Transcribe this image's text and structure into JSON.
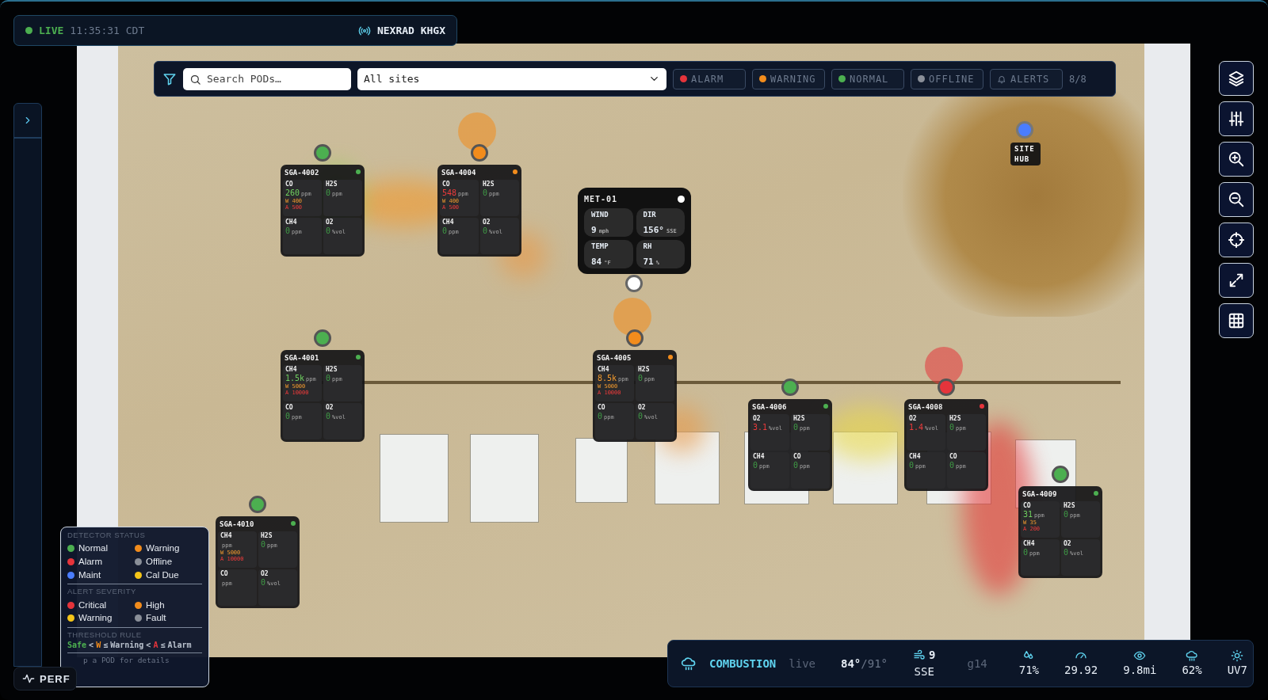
{
  "header": {
    "live_label": "LIVE",
    "live": true,
    "time": "11:35:31 CDT",
    "radar": "NEXRAD KHGX"
  },
  "filter_bar": {
    "search": {
      "placeholder": "Search PODs…"
    },
    "site_select": {
      "value": "All sites"
    },
    "chips": [
      {
        "label": "ALARM",
        "color": "#e5343b",
        "selected": false
      },
      {
        "label": "WARNING",
        "color": "#f28c1c",
        "selected": false
      },
      {
        "label": "NORMAL",
        "color": "#4caf50",
        "selected": false
      },
      {
        "label": "OFFLINE",
        "color": "#8a8f98",
        "selected": false
      },
      {
        "label": "ALERTS",
        "kind": "bell",
        "selected": false
      }
    ],
    "count": "8/8"
  },
  "pods": [
    {
      "id": "SGA-4002",
      "color": "#4caf50",
      "pulse": false,
      "cells": [
        {
          "gas": "CO",
          "value": "260",
          "unit": "ppm",
          "color": "#6fcf5f",
          "warn": "W 400",
          "alarm": "A 500"
        },
        {
          "gas": "H2S",
          "value": "0",
          "unit": "ppm",
          "color": "#3f9a45"
        },
        {
          "gas": "CH4",
          "value": "0",
          "unit": "ppm",
          "color": "#3f9a45"
        },
        {
          "gas": "O2",
          "value": "0",
          "unit": "%vol",
          "color": "#3f9a45"
        }
      ]
    },
    {
      "id": "SGA-4004",
      "color": "#f28c1c",
      "pulse": true,
      "cells": [
        {
          "gas": "CO",
          "value": "548",
          "unit": "ppm",
          "color": "#ee3b3b",
          "warn": "W 400",
          "alarm": "A 500"
        },
        {
          "gas": "H2S",
          "value": "0",
          "unit": "ppm",
          "color": "#3f9a45"
        },
        {
          "gas": "CH4",
          "value": "0",
          "unit": "ppm",
          "color": "#3f9a45"
        },
        {
          "gas": "O2",
          "value": "0",
          "unit": "%vol",
          "color": "#3f9a45"
        }
      ]
    },
    {
      "id": "SGA-4001",
      "color": "#4caf50",
      "pulse": false,
      "cells": [
        {
          "gas": "CH4",
          "value": "1.5k",
          "unit": "ppm",
          "color": "#6fcf5f",
          "warn": "W 5000",
          "alarm": "A 10000"
        },
        {
          "gas": "H2S",
          "value": "0",
          "unit": "ppm",
          "color": "#3f9a45"
        },
        {
          "gas": "CO",
          "value": "0",
          "unit": "ppm",
          "color": "#3f9a45"
        },
        {
          "gas": "O2",
          "value": "0",
          "unit": "%vol",
          "color": "#3f9a45"
        }
      ]
    },
    {
      "id": "SGA-4005",
      "color": "#f28c1c",
      "pulse": true,
      "cells": [
        {
          "gas": "CH4",
          "value": "8.5k",
          "unit": "ppm",
          "color": "#f29a2e",
          "warn": "W 5000",
          "alarm": "A 10000"
        },
        {
          "gas": "H2S",
          "value": "0",
          "unit": "ppm",
          "color": "#3f9a45"
        },
        {
          "gas": "CO",
          "value": "0",
          "unit": "ppm",
          "color": "#3f9a45"
        },
        {
          "gas": "O2",
          "value": "0",
          "unit": "%vol",
          "color": "#3f9a45"
        }
      ]
    },
    {
      "id": "SGA-4006",
      "color": "#4caf50",
      "pulse": false,
      "cells": [
        {
          "gas": "O2",
          "value": "3.1",
          "unit": "%vol",
          "color": "#ee3b3b"
        },
        {
          "gas": "H2S",
          "value": "0",
          "unit": "ppm",
          "color": "#3f9a45"
        },
        {
          "gas": "CH4",
          "value": "0",
          "unit": "ppm",
          "color": "#3f9a45"
        },
        {
          "gas": "CO",
          "value": "0",
          "unit": "ppm",
          "color": "#3f9a45"
        }
      ]
    },
    {
      "id": "SGA-4008",
      "color": "#e5343b",
      "pulse": true,
      "cells": [
        {
          "gas": "O2",
          "value": "1.4",
          "unit": "%vol",
          "color": "#ee3b3b"
        },
        {
          "gas": "H2S",
          "value": "0",
          "unit": "ppm",
          "color": "#3f9a45"
        },
        {
          "gas": "CH4",
          "value": "0",
          "unit": "ppm",
          "color": "#3f9a45"
        },
        {
          "gas": "CO",
          "value": "0",
          "unit": "ppm",
          "color": "#3f9a45"
        }
      ]
    },
    {
      "id": "SGA-4009",
      "color": "#4caf50",
      "pulse": false,
      "cells": [
        {
          "gas": "CO",
          "value": "31",
          "unit": "ppm",
          "color": "#6fcf5f",
          "warn": "W 35",
          "alarm": "A 200"
        },
        {
          "gas": "H2S",
          "value": "0",
          "unit": "ppm",
          "color": "#3f9a45"
        },
        {
          "gas": "CH4",
          "value": "0",
          "unit": "ppm",
          "color": "#3f9a45"
        },
        {
          "gas": "O2",
          "value": "0",
          "unit": "%vol",
          "color": "#3f9a45"
        }
      ]
    },
    {
      "id": "SGA-4010",
      "color": "#4caf50",
      "pulse": false,
      "cells": [
        {
          "gas": "CH4",
          "unit": "ppm",
          "warn": "W 5000",
          "alarm": "A 10000"
        },
        {
          "gas": "H2S",
          "value": "0",
          "unit": "ppm",
          "color": "#3f9a45"
        },
        {
          "gas": "CO",
          "unit": "ppm"
        },
        {
          "gas": "O2",
          "value": "0",
          "unit": "%vol",
          "color": "#3f9a45"
        }
      ]
    }
  ],
  "met_station": {
    "id": "MET-01",
    "cells": [
      {
        "label": "WIND",
        "value": "9",
        "unit": "mph"
      },
      {
        "label": "DIR",
        "value": "156°",
        "unit": "SSE"
      },
      {
        "label": "TEMP",
        "value": "84",
        "unit": "°F"
      },
      {
        "label": "RH",
        "value": "71",
        "unit": "%"
      }
    ]
  },
  "site_hub": {
    "label": "SITE HUB",
    "color": "#4a7dff"
  },
  "map_tools": [
    {
      "kind": "layers"
    },
    {
      "kind": "sliders"
    },
    {
      "kind": "zoom_in"
    },
    {
      "kind": "zoom_out"
    },
    {
      "kind": "locate"
    },
    {
      "kind": "expand"
    },
    {
      "kind": "grid"
    }
  ],
  "sidebar": {
    "expanded": false
  },
  "legend": {
    "sections": [
      {
        "title": "DETECTOR STATUS",
        "items": [
          {
            "label": "Normal",
            "color": "#4caf50"
          },
          {
            "label": "Warning",
            "color": "#f28c1c"
          },
          {
            "label": "Alarm",
            "color": "#e5343b"
          },
          {
            "label": "Offline",
            "color": "#8a8f98"
          },
          {
            "label": "Maint",
            "color": "#4a7dff"
          },
          {
            "label": "Cal Due",
            "color": "#f5c518"
          }
        ]
      },
      {
        "title": "ALERT SEVERITY",
        "items": [
          {
            "label": "Critical",
            "color": "#e5343b"
          },
          {
            "label": "High",
            "color": "#f28c1c"
          },
          {
            "label": "Warning",
            "color": "#f5c518"
          },
          {
            "label": "Fault",
            "color": "#8a8f98"
          }
        ]
      }
    ],
    "threshold_rule": {
      "title": "THRESHOLD RULE",
      "parts": [
        {
          "text": "Safe",
          "color": "#4caf50"
        },
        {
          "text": "<",
          "color": "#b8c0cc"
        },
        {
          "text": "W",
          "color": "#f28c1c"
        },
        {
          "text": "≤",
          "color": "#b8c0cc"
        },
        {
          "text": "Warning",
          "color": "#b8c0cc"
        },
        {
          "text": "<",
          "color": "#b8c0cc"
        },
        {
          "text": "A",
          "color": "#e5343b"
        },
        {
          "text": "≤",
          "color": "#b8c0cc"
        },
        {
          "text": "Alarm",
          "color": "#b8c0cc"
        }
      ]
    },
    "hint": "p a POD for details"
  },
  "perf_button": {
    "label": "PERF"
  },
  "weather": {
    "mode": "COMBUSTION",
    "source": "live",
    "temp": "84°",
    "temp_high": "/91°",
    "wind_speed": "9",
    "wind_dir": "SSE",
    "gust": "g14",
    "stats": [
      {
        "kind": "humidity",
        "value": "71%"
      },
      {
        "kind": "pressure",
        "value": "29.92"
      },
      {
        "kind": "visibility",
        "value": "9.8mi"
      },
      {
        "kind": "precip",
        "value": "62%"
      },
      {
        "kind": "uv",
        "value": "UV7"
      }
    ]
  }
}
